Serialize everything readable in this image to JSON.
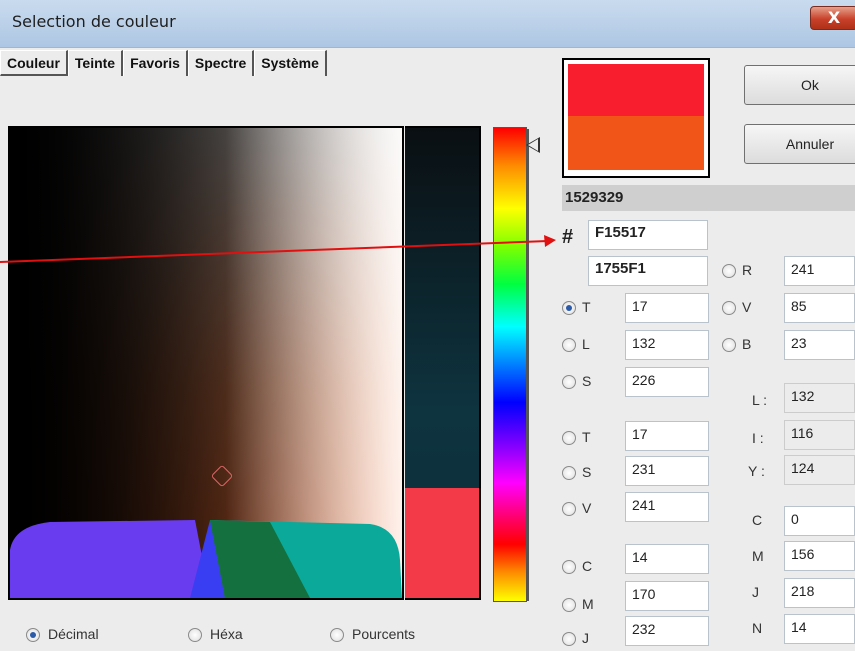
{
  "window": {
    "title": "Selection de couleur",
    "close_glyph": "X"
  },
  "tabs": [
    "Couleur",
    "Teinte",
    "Favoris",
    "Spectre",
    "Système"
  ],
  "buttons": {
    "ok": "Ok",
    "cancel": "Annuler"
  },
  "colors": {
    "new_color": "#F81E2E",
    "old_color": "#F15517",
    "hex_display": "F15517",
    "hue_marker": "#333333"
  },
  "decimal_value": "1529329",
  "hash_symbol": "#",
  "hex_value": "F15517",
  "hex_swapped": "1755F1",
  "labels": {
    "R": "R",
    "V": "V",
    "B": "B",
    "T1": "T",
    "L": "L",
    "S1": "S",
    "T2": "T",
    "S2": "S",
    "V2": "V",
    "C": "C",
    "M": "M",
    "J": "J",
    "Lcolon": "L :",
    "Icolon": "I :",
    "Ycolon": "Y :",
    "Cr": "C",
    "Mr": "M",
    "Jr": "J",
    "Nr": "N"
  },
  "values": {
    "R": "241",
    "V": "85",
    "B": "23",
    "T1": "17",
    "L": "132",
    "S1": "226",
    "L2": "132",
    "I": "116",
    "Y": "124",
    "T2": "17",
    "S2": "231",
    "V2": "241",
    "C": "14",
    "M": "170",
    "J": "232",
    "Cr": "0",
    "Mr": "156",
    "Jr": "218",
    "Nr": "14"
  },
  "format": {
    "decimal": "Décimal",
    "hexa": "Héxa",
    "percent": "Pourcents",
    "selected": "decimal"
  }
}
